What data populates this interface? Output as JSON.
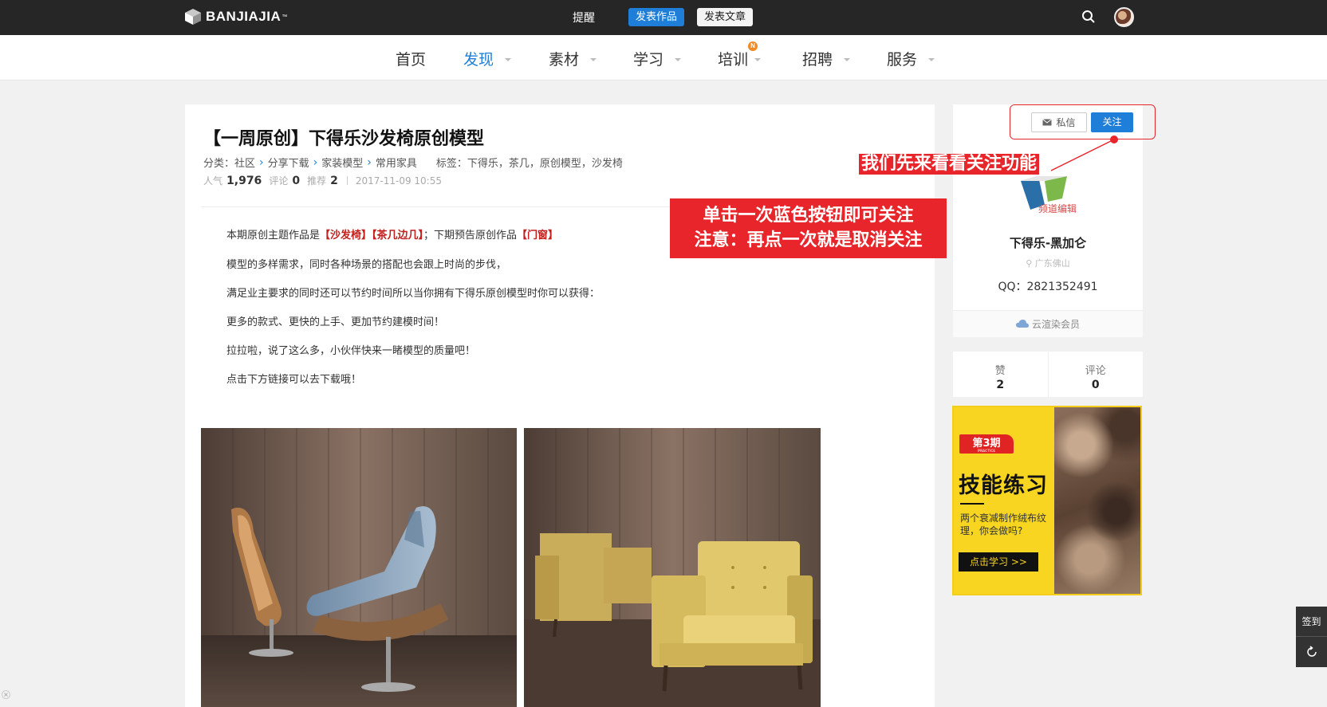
{
  "topbar": {
    "logo_text": "BANJIAJIA",
    "logo_tm": "™",
    "remind": "提醒",
    "publish_work": "发表作品",
    "publish_article": "发表文章"
  },
  "nav": {
    "items": [
      {
        "label": "首页"
      },
      {
        "label": "发现"
      },
      {
        "label": "素材"
      },
      {
        "label": "学习"
      },
      {
        "label": "培训"
      },
      {
        "label": "招聘"
      },
      {
        "label": "服务"
      }
    ],
    "active": "发现",
    "new_badge": "N"
  },
  "article": {
    "title": "【一周原创】下得乐沙发椅原创模型",
    "category_label": "分类：",
    "breadcrumb": [
      "社区",
      "分享下载",
      "家装模型",
      "常用家具"
    ],
    "tags_label": "标签：",
    "tags": "下得乐，茶几，原创模型，沙发椅",
    "stats": {
      "views_label": "人气",
      "views": "1,976",
      "comments_label": "评论",
      "comments": "0",
      "recommend_label": "推荐",
      "recommend": "2",
      "date": "2017-11-09 10:55"
    },
    "p1_a": "本期原创主题作品是",
    "p1_b": "【沙发椅】【茶几边几】",
    "p1_c": "；下期预告原创作品",
    "p1_d": "【门窗】",
    "p2": "模型的多样需求，同时各种场景的搭配也会跟上时尚的步伐，",
    "p3": "满足业主要求的同时还可以节约时间所以当你拥有下得乐原创模型时你可以获得：",
    "p4": "更多的款式、更快的上手、更加节约建模时间！",
    "p5": "拉拉啦，说了这么多，小伙伴快来一睹模型的质量吧！",
    "p6": "点击下方链接可以去下载哦！"
  },
  "profile": {
    "message_btn": "私信",
    "follow_btn": "关注",
    "logo_caption": "频道编辑",
    "name": "下得乐-黑加仑",
    "location": "广东佛山",
    "qq": "QQ：2821352491",
    "member": "云渲染会员"
  },
  "likes": {
    "like_label": "赞",
    "like_count": "2",
    "comment_label": "评论",
    "comment_count": "0"
  },
  "ad": {
    "issue": "第3期",
    "issue_sub": "PRACTICE",
    "title": "技能练习",
    "subtitle": "两个衰减制作绒布纹理，你会做吗?",
    "button": "点击学习 >>"
  },
  "float": {
    "sign": "签到"
  },
  "annotations": {
    "a1": "我们先来看看关注功能",
    "a2_line1": "单击一次蓝色按钮即可关注",
    "a2_line2": "注意：再点一次就是取消关注"
  },
  "colors": {
    "accent": "#1e7ed8",
    "annotation": "#e8252a",
    "topbar": "#262626",
    "ad_yellow": "#f7d521"
  }
}
